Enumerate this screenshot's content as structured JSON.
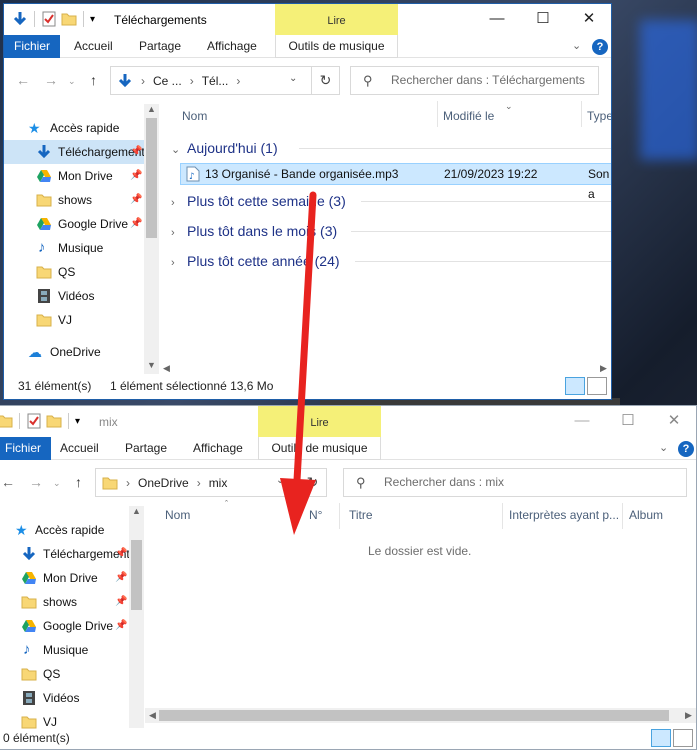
{
  "top_window": {
    "title": "Téléchargements",
    "context_tab": "Lire",
    "ribbon_tabs": [
      "Fichier",
      "Accueil",
      "Partage",
      "Affichage",
      "Outils de musique"
    ],
    "breadcrumbs": [
      "Ce ...",
      "Tél..."
    ],
    "search_placeholder": "Rechercher dans : Téléchargements",
    "nav_items": [
      {
        "label": "Accès rapide",
        "icon": "star-icon",
        "pinned": false
      },
      {
        "label": "Téléchargements",
        "icon": "download-arrow-icon",
        "pinned": true,
        "selected": true
      },
      {
        "label": "Mon Drive",
        "icon": "google-drive-icon",
        "pinned": true
      },
      {
        "label": "shows",
        "icon": "folder-icon",
        "pinned": true
      },
      {
        "label": "Google Drive",
        "icon": "google-drive-icon",
        "pinned": true
      },
      {
        "label": "Musique",
        "icon": "music-note-icon",
        "pinned": false
      },
      {
        "label": "QS",
        "icon": "folder-icon",
        "pinned": false
      },
      {
        "label": "Vidéos",
        "icon": "film-icon",
        "pinned": false
      },
      {
        "label": "VJ",
        "icon": "folder-icon",
        "pinned": false
      },
      {
        "label": "OneDrive",
        "icon": "cloud-icon",
        "pinned": false
      }
    ],
    "columns": [
      "Nom",
      "Modifié le",
      "Type"
    ],
    "groups": [
      {
        "label": "Aujourd'hui (1)",
        "expanded": true
      },
      {
        "label": "Plus tôt cette semaine (3)",
        "expanded": false
      },
      {
        "label": "Plus tôt dans le mois (3)",
        "expanded": false
      },
      {
        "label": "Plus tôt cette année (24)",
        "expanded": false
      }
    ],
    "file": {
      "name": "13 Organisé - Bande organisée.mp3",
      "modified": "21/09/2023 19:22",
      "type": "Son a"
    },
    "status": {
      "count": "31 élément(s)",
      "selection": "1 élément sélectionné 13,6 Mo"
    }
  },
  "bottom_window": {
    "title": "mix",
    "context_tab": "Lire",
    "ribbon_tabs": [
      "Fichier",
      "Accueil",
      "Partage",
      "Affichage",
      "Outils de musique"
    ],
    "breadcrumbs": [
      "OneDrive",
      "mix"
    ],
    "search_placeholder": "Rechercher dans : mix",
    "nav_items": [
      {
        "label": "Accès rapide",
        "icon": "star-icon",
        "pinned": false
      },
      {
        "label": "Téléchargements",
        "icon": "download-arrow-icon",
        "pinned": true
      },
      {
        "label": "Mon Drive",
        "icon": "google-drive-icon",
        "pinned": true
      },
      {
        "label": "shows",
        "icon": "folder-icon",
        "pinned": true
      },
      {
        "label": "Google Drive",
        "icon": "google-drive-icon",
        "pinned": true
      },
      {
        "label": "Musique",
        "icon": "music-note-icon",
        "pinned": false
      },
      {
        "label": "QS",
        "icon": "folder-icon",
        "pinned": false
      },
      {
        "label": "Vidéos",
        "icon": "film-icon",
        "pinned": false
      },
      {
        "label": "VJ",
        "icon": "folder-icon",
        "pinned": false
      }
    ],
    "columns": [
      "Nom",
      "N°",
      "Titre",
      "Interprètes ayant p...",
      "Album"
    ],
    "empty_message": "Le dossier est vide.",
    "status": {
      "count": "0 élément(s)"
    }
  },
  "colors": {
    "accent": "#1666c0",
    "context_tab": "#f5f078",
    "selection": "#cce8ff",
    "group_text": "#1e3287",
    "annotation_arrow": "#e8231f"
  }
}
